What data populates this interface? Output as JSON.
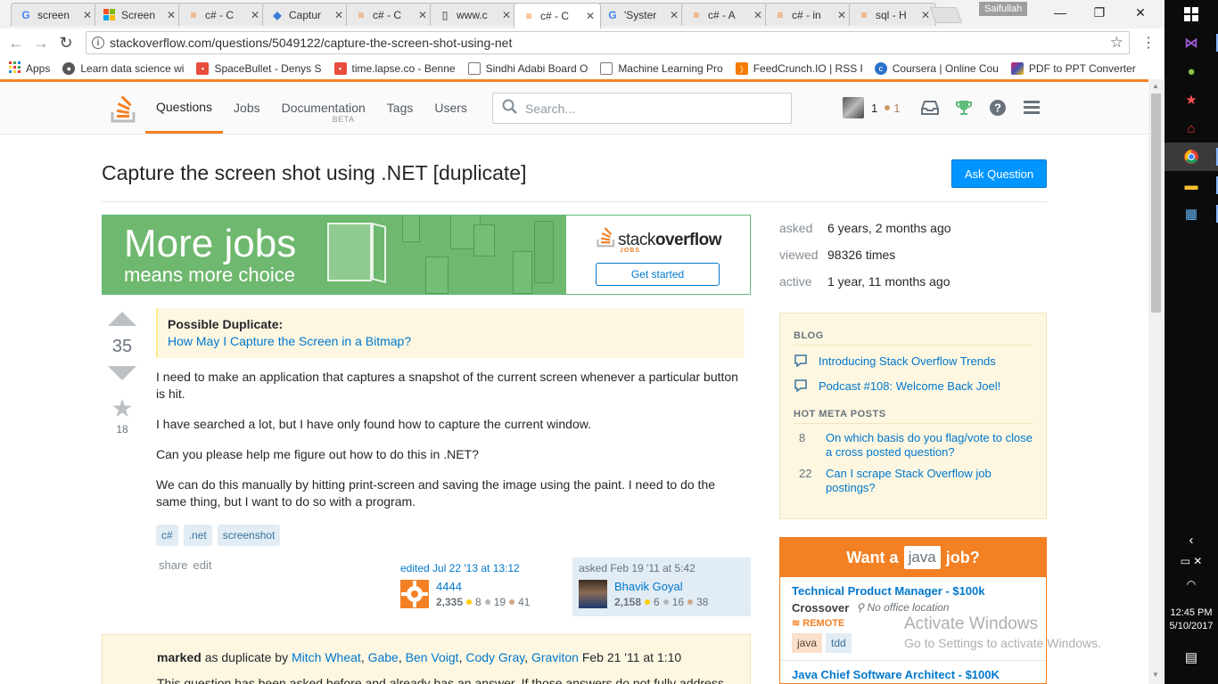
{
  "browser": {
    "tabs": [
      {
        "label": "screen",
        "icon": "google-icon",
        "color": "#4285f4"
      },
      {
        "label": "Screen",
        "icon": "microsoft-icon",
        "color": "#f25022"
      },
      {
        "label": "c# - C",
        "icon": "stackoverflow-icon",
        "color": "#f48024"
      },
      {
        "label": "Captur",
        "icon": "azure-icon",
        "color": "#3a7bd5"
      },
      {
        "label": "c# - C",
        "icon": "stackoverflow-icon",
        "color": "#f48024"
      },
      {
        "label": "www.c",
        "icon": "page-icon",
        "color": "#777777"
      },
      {
        "label": "c# - C",
        "icon": "stackoverflow-icon",
        "color": "#f48024"
      },
      {
        "label": "'Syster",
        "icon": "google-icon",
        "color": "#4285f4"
      },
      {
        "label": "c# - A",
        "icon": "stackoverflow-icon",
        "color": "#f48024"
      },
      {
        "label": "c# - in",
        "icon": "stackoverflow-icon",
        "color": "#f48024"
      },
      {
        "label": "sql - H",
        "icon": "stackoverflow-icon",
        "color": "#f48024"
      }
    ],
    "active_tab_index": 6,
    "user": "Saifullah",
    "url": "stackoverflow.com/questions/5049122/capture-the-screen-shot-using-net",
    "bookmarks": [
      {
        "label": "Apps",
        "icon": "apps-grid-icon",
        "color": "#e53935"
      },
      {
        "label": "Learn data science wi",
        "icon": "globe-icon",
        "color": "#555555"
      },
      {
        "label": "SpaceBullet - Denys S",
        "icon": "spacebullet-icon",
        "color": "#e74c3c"
      },
      {
        "label": "time.lapse.co - Benne",
        "icon": "timelapse-icon",
        "color": "#e74c3c"
      },
      {
        "label": "Sindhi Adabi Board O",
        "icon": "page-icon",
        "color": "#777777"
      },
      {
        "label": "Machine Learning Pro",
        "icon": "page-icon",
        "color": "#777777"
      },
      {
        "label": "FeedCrunch.IO | RSS F",
        "icon": "rss-icon",
        "color": "#f57c00"
      },
      {
        "label": "Coursera | Online Cou",
        "icon": "coursera-icon",
        "color": "#2a73cc"
      },
      {
        "label": "PDF to PPT Converter",
        "icon": "pdf-ppt-icon",
        "color": "#8e44ad"
      }
    ]
  },
  "so": {
    "nav": {
      "questions": "Questions",
      "jobs": "Jobs",
      "documentation": "Documentation",
      "beta": "BETA",
      "tags": "Tags",
      "users": "Users"
    },
    "search_placeholder": "Search...",
    "user_rep": "1",
    "user_bronze": "1"
  },
  "question": {
    "title": "Capture the screen shot using .NET [duplicate]",
    "ask_button": "Ask Question",
    "votes": "35",
    "favorites": "18",
    "duplicate_label": "Possible Duplicate:",
    "duplicate_link": "How May I Capture the Screen in a Bitmap?",
    "body": [
      "I need to make an application that captures a snapshot of the current screen whenever a particular button is hit.",
      "I have searched a lot, but I have only found how to capture the current window.",
      "Can you please help me figure out how to do this in .NET?",
      "We can do this manually by hitting print-screen and saving the image using the paint. I need to do the same thing, but I want to do so with a program."
    ],
    "tags": [
      "c#",
      ".net",
      "screenshot"
    ],
    "share": "share",
    "edit": "edit",
    "editor": {
      "action": "edited Jul 22 '13 at 13:12",
      "name": "4444",
      "rep": "2,335",
      "gold": "8",
      "silver": "19",
      "bronze": "41"
    },
    "asker": {
      "action": "asked Feb 19 '11 at 5:42",
      "name": "Bhavik Goyal",
      "rep": "2,158",
      "gold": "6",
      "silver": "16",
      "bronze": "38"
    },
    "marked": {
      "bold": "marked",
      "text": "as duplicate by",
      "users": [
        "Mitch Wheat",
        "Gabe",
        "Ben Voigt",
        "Cody Gray",
        "Graviton"
      ],
      "date": "Feb 21 '11 at 1:10",
      "note": "This question has been asked before and already has an answer. If those answers do not fully address your"
    }
  },
  "stats": {
    "asked_label": "asked",
    "asked_value": "6 years, 2 months ago",
    "viewed_label": "viewed",
    "viewed_value": "98326 times",
    "active_label": "active",
    "active_value": "1 year, 11 months ago"
  },
  "ad": {
    "headline": "More jobs",
    "subline": "means more choice",
    "brand_a": "stack",
    "brand_b": "overflow",
    "brand_sub": "JOBS",
    "cta": "Get started"
  },
  "sidebar": {
    "blog_heading": "BLOG",
    "blog_items": [
      "Introducing Stack Overflow Trends",
      "Podcast #108: Welcome Back Joel!"
    ],
    "meta_heading": "HOT META POSTS",
    "meta_items": [
      {
        "count": "8",
        "title": "On which basis do you flag/vote to close a cross posted question?"
      },
      {
        "count": "22",
        "title": "Can I scrape Stack Overflow job postings?"
      }
    ]
  },
  "jobs_widget": {
    "want_a": "Want a",
    "lang": "java",
    "job": "job?",
    "job1_title": "Technical Product Manager - $100k",
    "job1_company": "Crossover",
    "job1_location": "No office location",
    "job1_remote": "REMOTE",
    "job1_tags": [
      "java",
      "tdd"
    ],
    "job2_title": "Java Chief Software Architect - $100K"
  },
  "watermark": {
    "line1": "Activate Windows",
    "line2": "Go to Settings to activate Windows."
  },
  "taskbar": {
    "time": "12:45 PM",
    "date": "5/10/2017"
  },
  "colors": {
    "so_orange": "#f48024",
    "link_blue": "#0077cc",
    "ask_blue": "#0095ff",
    "notice_yellow": "#fdf7e2"
  }
}
